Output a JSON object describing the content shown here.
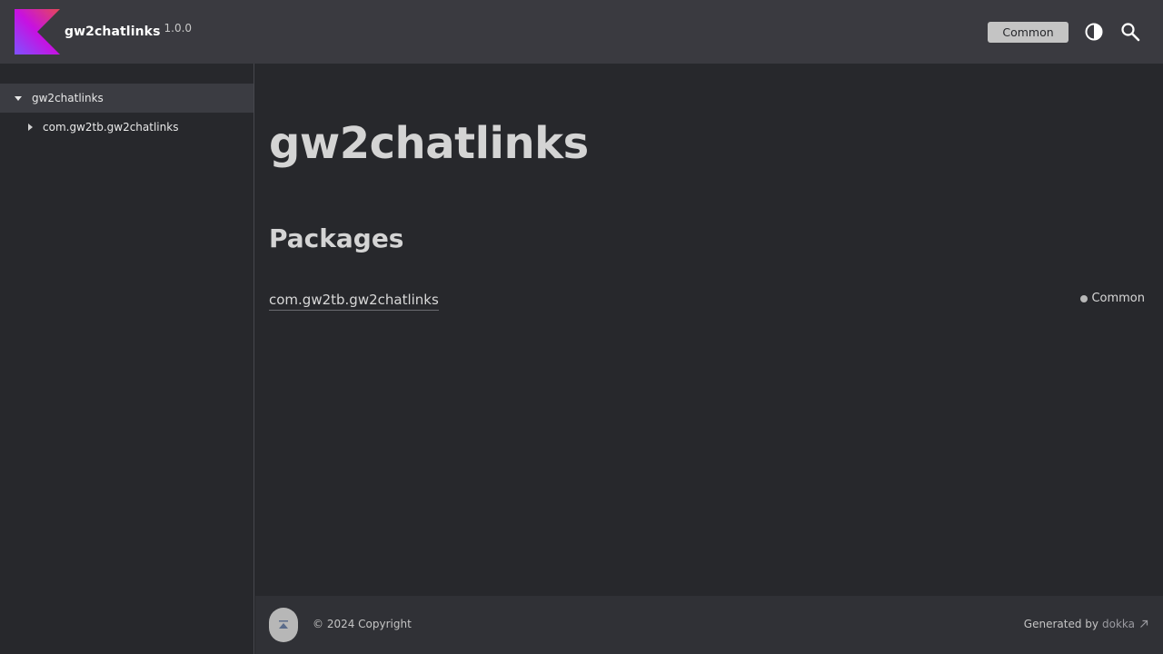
{
  "header": {
    "brand_name": "gw2chatlinks",
    "version": "1.0.0",
    "platform_filter": "Common",
    "logo_icon": "kotlin-logo-icon",
    "theme_icon": "theme-toggle-icon",
    "search_icon": "search-icon"
  },
  "sidebar": {
    "items": [
      {
        "label": "gw2chatlinks",
        "expanded": true,
        "selected": true
      },
      {
        "label": "com.gw2tb.gw2chatlinks",
        "expanded": false,
        "selected": false
      }
    ]
  },
  "main": {
    "title": "gw2chatlinks",
    "section_title": "Packages",
    "packages": [
      {
        "name": "com.gw2tb.gw2chatlinks",
        "platform": "Common"
      }
    ]
  },
  "footer": {
    "copyright": "© 2024 Copyright",
    "generated_by": "Generated by",
    "generator": "dokka",
    "scroll_top_icon": "scroll-to-top-icon"
  },
  "colors": {
    "background": "#27282c",
    "header": "#3a3a40",
    "accent_gradient": [
      "#8d2bf4",
      "#e34190"
    ]
  }
}
